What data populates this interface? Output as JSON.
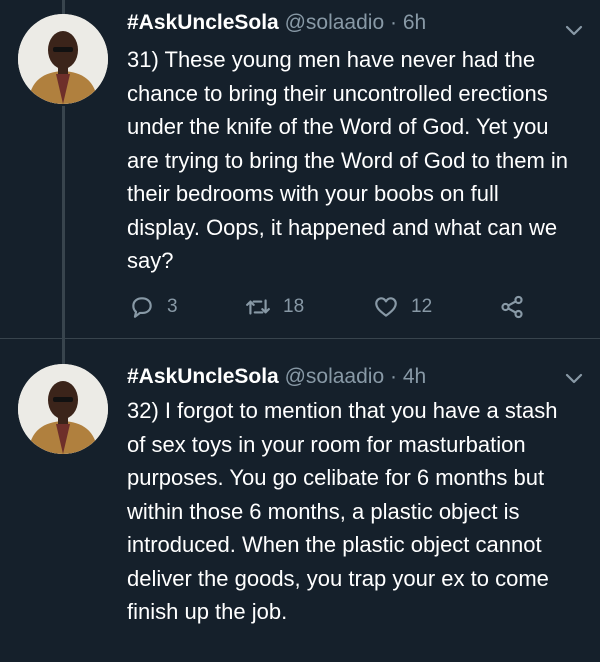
{
  "tweets": [
    {
      "display_name": "#AskUncleSola",
      "handle": "@solaadio",
      "dot": "·",
      "time": "6h",
      "text": "31) These young men have never had the chance to bring their uncontrolled erections under the knife of the Word of God. Yet you are trying to bring the Word of God to them in their bedrooms with your boobs on full display. Oops, it happened and what can we say?",
      "replies": "3",
      "retweets": "18",
      "likes": "12"
    },
    {
      "display_name": "#AskUncleSola",
      "handle": "@solaadio",
      "dot": "·",
      "time": "4h",
      "text": "32) I forgot to mention that you have a stash of sex toys in your room for masturbation purposes. You go celibate for 6 months but within those 6 months, a plastic object is introduced. When the plastic object cannot deliver the goods, you trap your ex to come finish up the job."
    }
  ],
  "icons": {
    "reply": "reply-icon",
    "retweet": "retweet-icon",
    "like": "heart-icon",
    "share": "share-icon",
    "caret": "chevron-down-icon"
  },
  "colors": {
    "background": "#15202b",
    "text": "#ffffff",
    "secondary": "#8899a6",
    "thread_line": "#38444d"
  }
}
